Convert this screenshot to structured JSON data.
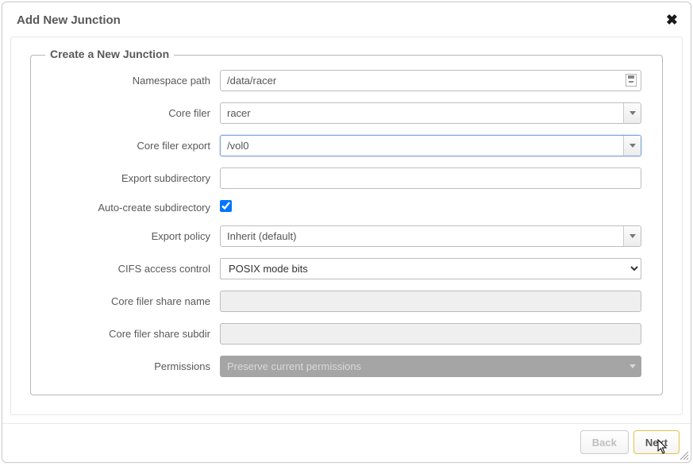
{
  "dialog": {
    "title": "Add New Junction",
    "fieldset_legend": "Create a New Junction"
  },
  "fields": {
    "namespace_path": {
      "label": "Namespace path",
      "value": "/data/racer"
    },
    "core_filer": {
      "label": "Core filer",
      "value": "racer"
    },
    "core_filer_export": {
      "label": "Core filer export",
      "value": "/vol0"
    },
    "export_subdirectory": {
      "label": "Export subdirectory",
      "value": ""
    },
    "auto_create_subdir": {
      "label": "Auto-create subdirectory",
      "checked": true
    },
    "export_policy": {
      "label": "Export policy",
      "value": "Inherit (default)"
    },
    "cifs_access_control": {
      "label": "CIFS access control",
      "value": "POSIX mode bits"
    },
    "core_filer_share_name": {
      "label": "Core filer share name",
      "value": ""
    },
    "core_filer_share_subdir": {
      "label": "Core filer share subdir",
      "value": ""
    },
    "permissions": {
      "label": "Permissions",
      "value": "Preserve current permissions"
    }
  },
  "buttons": {
    "back": "Back",
    "next": "Next"
  }
}
